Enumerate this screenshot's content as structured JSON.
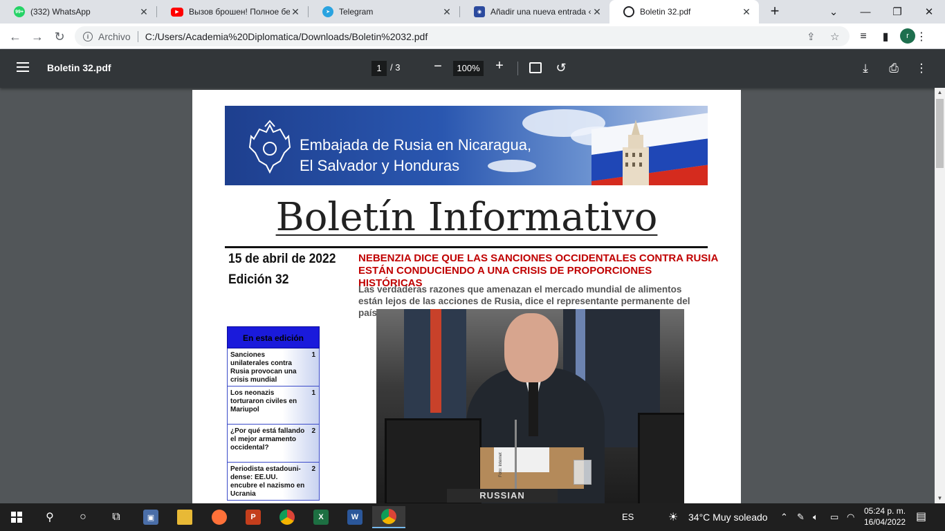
{
  "tabs": [
    {
      "title": "(332) WhatsApp",
      "badge": "99+",
      "color": "#25d366",
      "active": false
    },
    {
      "title": "Вызов брошен! Полное без",
      "color": "#ff0000",
      "active": false
    },
    {
      "title": "Telegram",
      "color": "#2aa3e0",
      "active": false
    },
    {
      "title": "Añadir una nueva entrada ‹",
      "color": "#2b4a9e",
      "active": false
    },
    {
      "title": "Boletin 32.pdf",
      "color": "#202124",
      "active": true
    }
  ],
  "address": {
    "scheme": "Archivo",
    "url": "C:/Users/Academia%20Diplomatica/Downloads/Boletin%2032.pdf"
  },
  "profile_initial": "r",
  "pdf": {
    "title": "Boletin 32.pdf",
    "current_page": "1",
    "total_pages": "/  3",
    "zoom": "100%"
  },
  "document": {
    "banner_line1": "Embajada de Rusia en Nicaragua,",
    "banner_line2": "El Salvador y Honduras",
    "title": "Boletín Informativo",
    "date": "15 de abril de 2022",
    "edition": "Edición 32",
    "headline": "NEBENZIA DICE QUE LAS SANCIONES OCCIDENTALES CONTRA RUSIA ESTÁN CONDUCIENDO A UNA CRISIS DE PROPORCIONES HISTÓRICAS",
    "subhead": "Las verdaderas razones que amenazan el mercado mundial de alimentos están lejos de las acciones de Rusia, dice el representante permanente del país ante la ONU",
    "toc_header": "En esta edición",
    "toc": [
      {
        "text": "Sanciones unilaterales contra Rusia provocan una crisis mundial",
        "page": "1"
      },
      {
        "text": "Los neonazis torturaron civiles en Mariupol",
        "page": "1"
      },
      {
        "text": "¿Por qué está fallando el mejor armamento occidental?",
        "page": "2"
      },
      {
        "text": "Periodista estadouni-dense: EE.UU. encubre el nazismo en Ucrania",
        "page": "2"
      }
    ],
    "nameplate": "RUSSIAN FEDERATION",
    "photo_credit": "Foto: Internet"
  },
  "taskbar": {
    "language": "ES",
    "weather": "34°C  Muy soleado",
    "time": "05:24 p. m.",
    "date": "16/04/2022"
  }
}
